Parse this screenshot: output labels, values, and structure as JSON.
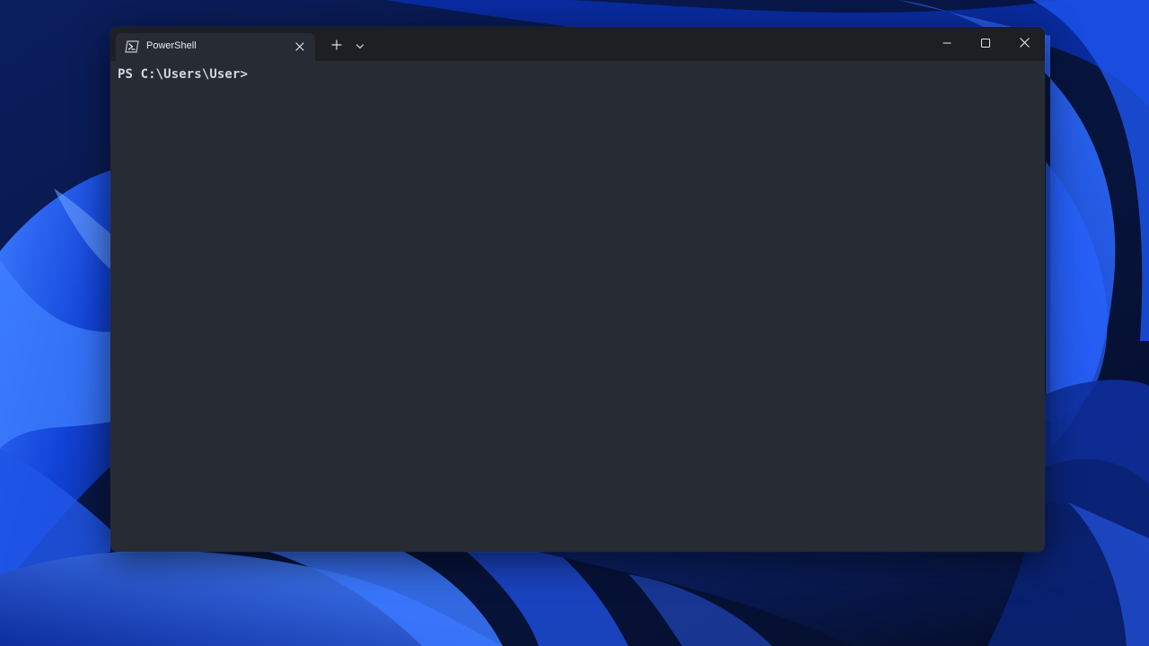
{
  "window": {
    "tab_title": "PowerShell",
    "tab_icon": "powershell-icon",
    "new_tab_icon": "plus-icon",
    "dropdown_icon": "chevron-down-icon",
    "caption_icons": [
      "minimize-icon",
      "maximize-icon",
      "close-icon"
    ]
  },
  "terminal": {
    "prompt": "PS C:\\Users\\User>"
  },
  "colors": {
    "terminal_background": "#272b33",
    "title_bar_background": "#1d1f23",
    "text": "#d4d6da",
    "wallpaper_accent": "#1e5bff"
  }
}
